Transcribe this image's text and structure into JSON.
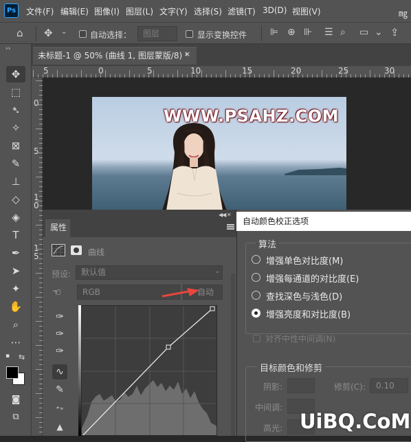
{
  "app": {
    "logo": "Ps"
  },
  "menu": [
    "文件(F)",
    "编辑(E)",
    "图像(I)",
    "图层(L)",
    "文字(Y)",
    "选择(S)",
    "滤镜(T)",
    "3D(D)",
    "视图(V)"
  ],
  "window_control_glyph": "㎎",
  "options_bar": {
    "auto_select_label": "自动选择：",
    "layer_dropdown": "图层",
    "show_transform_label": "显示变换控件"
  },
  "document_tab": {
    "title": "未标题-1 @ 50% (曲线 1, 图层蒙版/8) *",
    "close": "×"
  },
  "ruler_h_labels": [
    "5",
    "0",
    "5",
    "10",
    "15",
    "20",
    "25",
    "30"
  ],
  "ruler_v_labels": [
    "0",
    "5",
    "1\n0",
    "1\n5"
  ],
  "canvas": {
    "watermark": "WWW.PSAHZ.COM"
  },
  "properties_panel": {
    "tab": "属性",
    "adjustment_name": "曲线",
    "preset_label": "预设:",
    "preset_value": "默认值",
    "channel_value": "RGB",
    "auto_button": "自动"
  },
  "dialog": {
    "title": "自动颜色校正选项",
    "algorithm_group": "算法",
    "options": [
      {
        "label": "增强单色对比度(M)",
        "selected": false
      },
      {
        "label": "增强每通道的对比度(E)",
        "selected": false
      },
      {
        "label": "查找深色与浅色(D)",
        "selected": false
      },
      {
        "label": "增强亮度和对比度(B)",
        "selected": true
      }
    ],
    "snap_neutral": "对齐中性中间调(N)",
    "target_group": "目标颜色和修剪",
    "shadows_label": "阴影:",
    "midtones_label": "中间调:",
    "highlights_label": "高光:",
    "clip_label": "修剪(C):",
    "clip_value": "0.10"
  },
  "site_watermark": "UiBQ.CoM",
  "colors": {
    "accent_arrow": "#e8473f",
    "ps_blue": "#31a8ff"
  }
}
